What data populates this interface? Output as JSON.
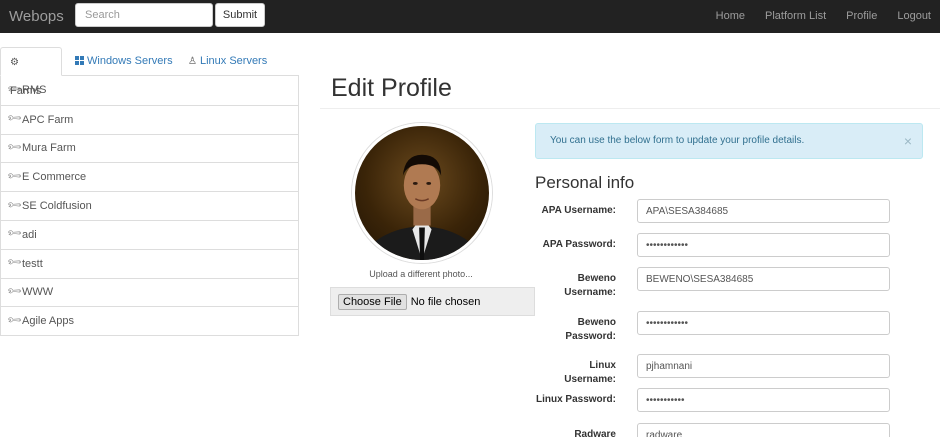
{
  "nav": {
    "brand": "Webops",
    "search_placeholder": "Search",
    "submit_label": "Submit",
    "links": [
      "Home",
      "Platform List",
      "Profile",
      "Logout"
    ]
  },
  "sidebar": {
    "tabs": [
      {
        "label": "Farms",
        "icon": "gear-icon"
      },
      {
        "label": "Windows Servers",
        "icon": "windows-icon"
      },
      {
        "label": "Linux Servers",
        "icon": "linux-icon"
      }
    ],
    "items": [
      "RMS",
      "APC Farm",
      "Mura Farm",
      "E Commerce",
      "SE Coldfusion",
      "adi",
      "testt",
      "WWW",
      "Agile Apps"
    ],
    "item_icon": "wrench-icon"
  },
  "main": {
    "title": "Edit Profile",
    "upload_text": "Upload a different photo...",
    "choose_file_label": "Choose File",
    "no_file_text": "No file chosen",
    "alert_text": "You can use the below form to update your profile details.",
    "alert_close": "×",
    "section_title": "Personal info",
    "fields": [
      {
        "label": "APA Username:",
        "value": "APA\\SESA384685"
      },
      {
        "label": "APA Password:",
        "value": "••••••••••••"
      },
      {
        "label": "Beweno Username:",
        "value": "BEWENO\\SESA384685"
      },
      {
        "label": "Beweno Password:",
        "value": "••••••••••••"
      },
      {
        "label": "Linux Username:",
        "value": "pjhamnani"
      },
      {
        "label": "Linux Password:",
        "value": "•••••••••••"
      },
      {
        "label": "Radware",
        "value": "radware"
      }
    ]
  },
  "colors": {
    "navbar": "#222222",
    "link": "#337ab7",
    "alert_bg": "#d9edf7",
    "alert_text": "#31708f"
  }
}
